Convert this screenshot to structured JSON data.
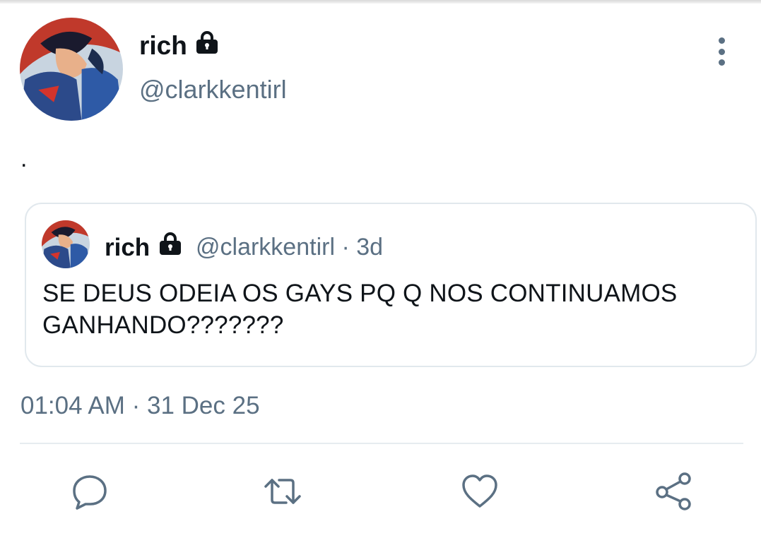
{
  "tweet": {
    "author_name": "rich",
    "author_handle": "@clarkkentirl",
    "body": ".",
    "timestamp": "01:04 AM · 31 Dec 25"
  },
  "quoted": {
    "author_name": "rich",
    "author_handle": "@clarkkentirl · 3d",
    "text": "SE DEUS ODEIA OS GAYS PQ Q NOS CONTINUAMOS GANHANDO???????"
  },
  "icons": {
    "lock": "lock-icon",
    "more": "more-vertical-icon",
    "reply": "reply-icon",
    "retweet": "retweet-icon",
    "like": "heart-icon",
    "share": "share-icon"
  },
  "colors": {
    "text": "#0f1419",
    "secondary": "#5b7083",
    "border": "#e1e8ed"
  }
}
